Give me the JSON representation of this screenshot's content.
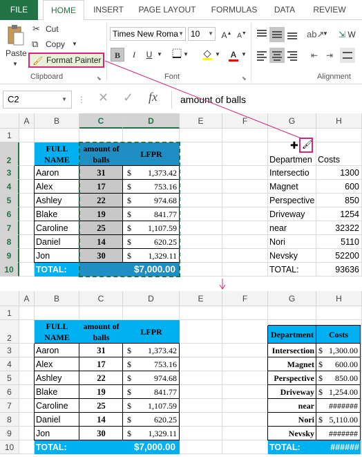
{
  "tabs": [
    "FILE",
    "HOME",
    "INSERT",
    "PAGE LAYOUT",
    "FORMULAS",
    "DATA",
    "REVIEW"
  ],
  "clipboard": {
    "paste": "Paste",
    "cut": "Cut",
    "copy": "Copy",
    "format_painter": "Format Painter",
    "group": "Clipboard"
  },
  "font": {
    "name": "Times New Roma",
    "size": "10",
    "bold": "B",
    "italic": "I",
    "underline": "U",
    "group": "Font"
  },
  "alignment": {
    "group": "Alignment",
    "wrap": "W"
  },
  "formula_bar": {
    "name_box": "C2",
    "fx": "fx",
    "content": "amount of balls"
  },
  "columns": [
    "A",
    "B",
    "C",
    "D",
    "E",
    "F",
    "G",
    "H"
  ],
  "rows": [
    "1",
    "2",
    "3",
    "4",
    "5",
    "6",
    "7",
    "8",
    "9",
    "10"
  ],
  "top_table": {
    "headers": [
      "FULL NAME",
      "amount of balls",
      "LFPR"
    ],
    "header_lines": [
      [
        "FULL",
        "NAME"
      ],
      [
        "amount of",
        "balls"
      ],
      [
        "LFPR"
      ]
    ],
    "rows": [
      [
        "Aaron",
        "31",
        "$",
        "1,373.42"
      ],
      [
        "Alex",
        "17",
        "$",
        "753.16"
      ],
      [
        "Ashley",
        "22",
        "$",
        "974.68"
      ],
      [
        "Blake",
        "19",
        "$",
        "841.77"
      ],
      [
        "Caroline",
        "25",
        "$",
        "1,107.59"
      ],
      [
        "Daniel",
        "14",
        "$",
        "620.25"
      ],
      [
        "Jon",
        "30",
        "$",
        "1,329.11"
      ]
    ],
    "total_label": "TOTAL:",
    "total_value": "$7,000.00"
  },
  "top_right": {
    "headers": [
      "Departmen",
      "Costs"
    ],
    "rows": [
      [
        "Intersectio",
        "1300"
      ],
      [
        "Magnet",
        "600"
      ],
      [
        "Perspective",
        "850"
      ],
      [
        "Driveway",
        "1254"
      ],
      [
        "near",
        "32322"
      ],
      [
        "Nori",
        "5110"
      ],
      [
        "Nevsky",
        "52200"
      ]
    ],
    "total_label": "TOTAL:",
    "total_value": "93636"
  },
  "bottom_right": {
    "headers": [
      "Department",
      "Costs"
    ],
    "rows": [
      [
        "Intersection",
        "$",
        "1,300.00"
      ],
      [
        "Magnet",
        "$",
        "600.00"
      ],
      [
        "Perspective",
        "$",
        "850.00"
      ],
      [
        "Driveway",
        "$",
        "1,254.00"
      ],
      [
        "near",
        "",
        "#######"
      ],
      [
        "Nori",
        "$",
        "5,110.00"
      ],
      [
        "Nevsky",
        "",
        "#######"
      ]
    ],
    "total_label": "TOTAL:",
    "total_value": "######"
  },
  "colors": {
    "accent": "#217346",
    "table_blue": "#00b0f0",
    "dark_blue": "#1f8ec3",
    "pink": "#d6237d",
    "selected_gray": "#c8c8c8"
  }
}
